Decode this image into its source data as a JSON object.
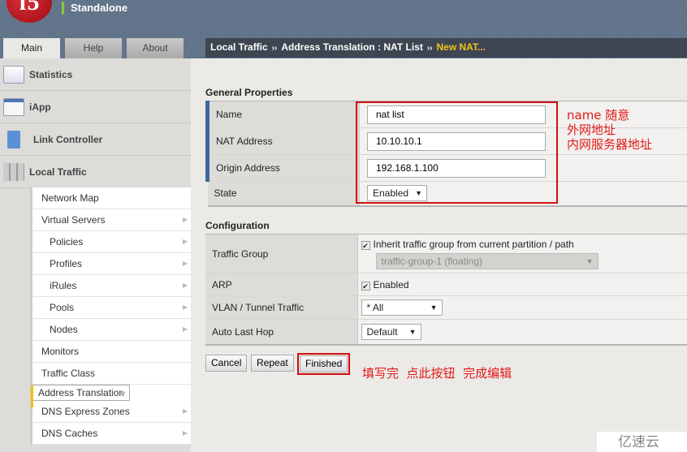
{
  "header": {
    "logo": "f5",
    "status": "Standalone"
  },
  "tabs": [
    {
      "label": "Main"
    },
    {
      "label": "Help"
    },
    {
      "label": "About"
    }
  ],
  "sidebar": {
    "items": [
      {
        "label": "Statistics",
        "icon": "chart-icon"
      },
      {
        "label": "iApp",
        "icon": "app-gear-icon"
      },
      {
        "label": "Link Controller",
        "icon": "server-icon"
      },
      {
        "label": "Local Traffic",
        "icon": "cylinders-icon"
      }
    ],
    "submenu": [
      {
        "label": "Network Map",
        "arrow": false
      },
      {
        "label": "Virtual Servers",
        "arrow": true
      },
      {
        "label": "Policies",
        "arrow": true
      },
      {
        "label": "Profiles",
        "arrow": true
      },
      {
        "label": "iRules",
        "arrow": true
      },
      {
        "label": "Pools",
        "arrow": true
      },
      {
        "label": "Nodes",
        "arrow": true
      },
      {
        "label": "Monitors",
        "arrow": false
      },
      {
        "label": "Traffic Class",
        "arrow": false
      },
      {
        "label": "Address Translation",
        "arrow": true,
        "selected": true
      },
      {
        "label": "DNS Express Zones",
        "arrow": true
      },
      {
        "label": "DNS Caches",
        "arrow": true
      }
    ]
  },
  "breadcrumb": {
    "items": [
      "Local Traffic",
      "Address Translation : NAT List"
    ],
    "current": "New NAT...",
    "sep": "››"
  },
  "general": {
    "title": "General Properties",
    "name_label": "Name",
    "name_value": "nat list",
    "nat_label": "NAT Address",
    "nat_value": "10.10.10.1",
    "origin_label": "Origin Address",
    "origin_value": "192.168.1.100",
    "state_label": "State",
    "state_value": "Enabled"
  },
  "config": {
    "title": "Configuration",
    "tg_label": "Traffic Group",
    "tg_inherit": "Inherit traffic group from current partition / path",
    "tg_value": "traffic-group-1 (floating)",
    "arp_label": "ARP",
    "arp_value": "Enabled",
    "vlan_label": "VLAN / Tunnel Traffic",
    "vlan_value": "* All",
    "alh_label": "Auto Last Hop",
    "alh_value": "Default"
  },
  "buttons": {
    "cancel": "Cancel",
    "repeat": "Repeat",
    "finished": "Finished"
  },
  "annotations": {
    "name": "name 随意",
    "nat": "外网地址",
    "origin": "内网服务器地址",
    "finish": "填写完  点此按钮  完成编辑",
    "color": "#e21a1a"
  },
  "watermark": "亿速云"
}
